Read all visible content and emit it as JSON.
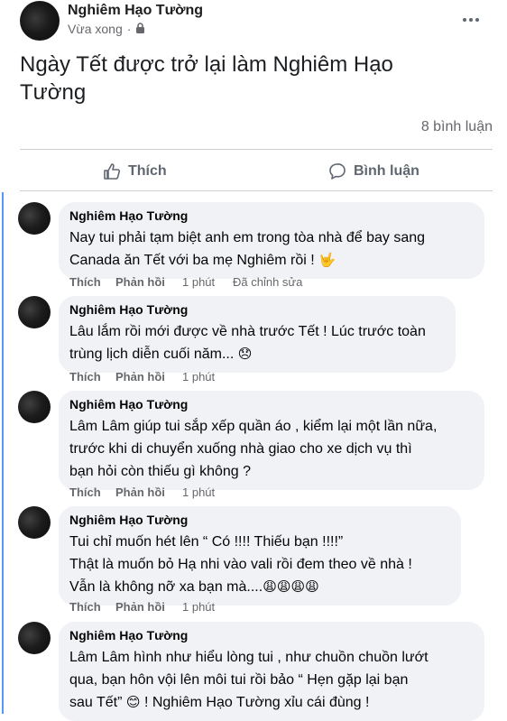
{
  "post": {
    "author": "Nghiêm Hạo Tường",
    "time": "Vừa xong",
    "separator": "·",
    "text_line1": "Ngày Tết được trở lại làm Nghiêm Hạo",
    "text_line2": "Tường",
    "comment_count": "8 bình luận"
  },
  "actions": {
    "like": "Thích",
    "comment": "Bình luận"
  },
  "comments": [
    {
      "author": "Nghiêm Hạo Tường",
      "line1": "Nay tui phải tạm biệt anh em trong tòa nhà để bay sang",
      "line2": "Canada ăn Tết với ba mẹ Nghiêm rồi !",
      "emoji": "🤟",
      "like": "Thích",
      "reply": "Phản hồi",
      "time": "1 phút",
      "edited": "Đã chỉnh sửa"
    },
    {
      "author": "Nghiêm Hạo Tường",
      "line1": "Lâu lắm rồi mới được về nhà trước Tết ! Lúc trước toàn",
      "line2": "trùng lịch diễn cuối năm...",
      "emoji": "😞",
      "like": "Thích",
      "reply": "Phản hồi",
      "time": "1 phút"
    },
    {
      "author": "Nghiêm Hạo Tường",
      "line1": "Lâm Lâm giúp tui sắp xếp quần áo , kiểm lại một lần nữa,",
      "line2": "trước khi di chuyển xuống nhà giao cho xe dịch vụ thì",
      "line3": "bạn hỏi còn thiếu gì không ?",
      "like": "Thích",
      "reply": "Phản hồi",
      "time": "1 phút"
    },
    {
      "author": "Nghiêm Hạo Tường",
      "line1": "Tui chỉ muốn hét lên “ Có !!!! Thiếu bạn !!!!”",
      "line2": "Thật là muốn bỏ Hạ nhi vào vali rồi đem theo về nhà !",
      "line3": "Vẫn là không nỡ xa bạn mà....",
      "emoji": "😩😩😩😩",
      "like": "Thích",
      "reply": "Phản hồi",
      "time": "1 phút"
    },
    {
      "author": "Nghiêm Hạo Tường",
      "line1": "Lâm Lâm hình như hiểu lòng tui , như chuồn chuồn lướt",
      "line2": "qua, bạn hôn vội lên môi tui rồi bảo “ Hẹn gặp lại bạn",
      "line3a": "sau Tết”",
      "emoji": "😊",
      "line3b": "! Nghiêm Hạo Tường xỉu cái đùng !"
    }
  ]
}
